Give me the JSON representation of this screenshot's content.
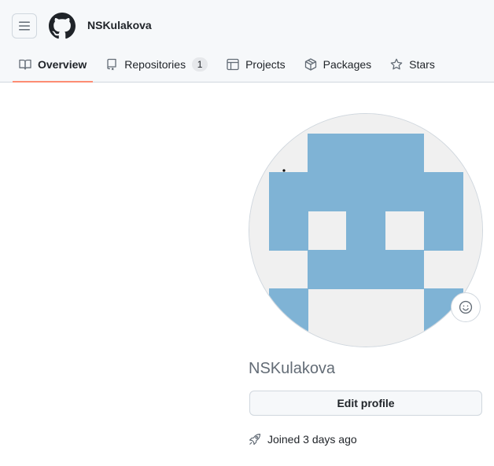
{
  "header": {
    "menu_icon": "hamburger-icon",
    "logo_icon": "github-mark-icon",
    "username": "NSKulakova"
  },
  "nav": {
    "tabs": [
      {
        "label": "Overview",
        "icon": "book-icon",
        "selected": true
      },
      {
        "label": "Repositories",
        "icon": "repo-icon",
        "count": "1"
      },
      {
        "label": "Projects",
        "icon": "table-icon"
      },
      {
        "label": "Packages",
        "icon": "package-icon"
      },
      {
        "label": "Stars",
        "icon": "star-icon"
      }
    ]
  },
  "profile": {
    "avatar_color": "#7fb3d5",
    "avatar_bg": "#f0f0f0",
    "status_icon": "smiley-icon",
    "name": "NSKulakova",
    "edit_label": "Edit profile",
    "joined_icon": "rocket-icon",
    "joined_text": "Joined 3 days ago"
  },
  "colors": {
    "accent_underline": "#fd8c73",
    "header_bg": "#f6f8fa",
    "border": "#d0d7de"
  }
}
